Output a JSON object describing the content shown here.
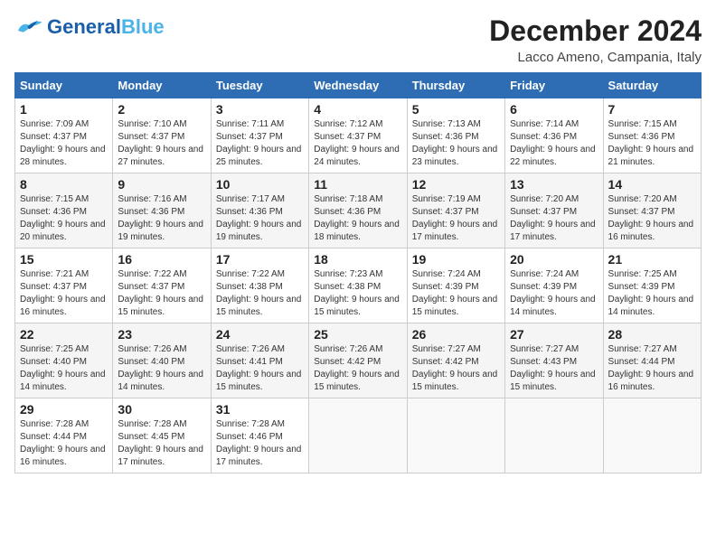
{
  "header": {
    "logo_general": "General",
    "logo_blue": "Blue",
    "month_title": "December 2024",
    "location": "Lacco Ameno, Campania, Italy"
  },
  "calendar": {
    "weekdays": [
      "Sunday",
      "Monday",
      "Tuesday",
      "Wednesday",
      "Thursday",
      "Friday",
      "Saturday"
    ],
    "weeks": [
      [
        null,
        null,
        null,
        null,
        null,
        null,
        null
      ]
    ],
    "days": [
      {
        "date": 1,
        "weekday": 0,
        "sunrise": "7:09 AM",
        "sunset": "4:37 PM",
        "daylight": "9 hours and 28 minutes"
      },
      {
        "date": 2,
        "weekday": 1,
        "sunrise": "7:10 AM",
        "sunset": "4:37 PM",
        "daylight": "9 hours and 27 minutes"
      },
      {
        "date": 3,
        "weekday": 2,
        "sunrise": "7:11 AM",
        "sunset": "4:37 PM",
        "daylight": "9 hours and 25 minutes"
      },
      {
        "date": 4,
        "weekday": 3,
        "sunrise": "7:12 AM",
        "sunset": "4:37 PM",
        "daylight": "9 hours and 24 minutes"
      },
      {
        "date": 5,
        "weekday": 4,
        "sunrise": "7:13 AM",
        "sunset": "4:36 PM",
        "daylight": "9 hours and 23 minutes"
      },
      {
        "date": 6,
        "weekday": 5,
        "sunrise": "7:14 AM",
        "sunset": "4:36 PM",
        "daylight": "9 hours and 22 minutes"
      },
      {
        "date": 7,
        "weekday": 6,
        "sunrise": "7:15 AM",
        "sunset": "4:36 PM",
        "daylight": "9 hours and 21 minutes"
      },
      {
        "date": 8,
        "weekday": 0,
        "sunrise": "7:15 AM",
        "sunset": "4:36 PM",
        "daylight": "9 hours and 20 minutes"
      },
      {
        "date": 9,
        "weekday": 1,
        "sunrise": "7:16 AM",
        "sunset": "4:36 PM",
        "daylight": "9 hours and 19 minutes"
      },
      {
        "date": 10,
        "weekday": 2,
        "sunrise": "7:17 AM",
        "sunset": "4:36 PM",
        "daylight": "9 hours and 19 minutes"
      },
      {
        "date": 11,
        "weekday": 3,
        "sunrise": "7:18 AM",
        "sunset": "4:36 PM",
        "daylight": "9 hours and 18 minutes"
      },
      {
        "date": 12,
        "weekday": 4,
        "sunrise": "7:19 AM",
        "sunset": "4:37 PM",
        "daylight": "9 hours and 17 minutes"
      },
      {
        "date": 13,
        "weekday": 5,
        "sunrise": "7:20 AM",
        "sunset": "4:37 PM",
        "daylight": "9 hours and 17 minutes"
      },
      {
        "date": 14,
        "weekday": 6,
        "sunrise": "7:20 AM",
        "sunset": "4:37 PM",
        "daylight": "9 hours and 16 minutes"
      },
      {
        "date": 15,
        "weekday": 0,
        "sunrise": "7:21 AM",
        "sunset": "4:37 PM",
        "daylight": "9 hours and 16 minutes"
      },
      {
        "date": 16,
        "weekday": 1,
        "sunrise": "7:22 AM",
        "sunset": "4:37 PM",
        "daylight": "9 hours and 15 minutes"
      },
      {
        "date": 17,
        "weekday": 2,
        "sunrise": "7:22 AM",
        "sunset": "4:38 PM",
        "daylight": "9 hours and 15 minutes"
      },
      {
        "date": 18,
        "weekday": 3,
        "sunrise": "7:23 AM",
        "sunset": "4:38 PM",
        "daylight": "9 hours and 15 minutes"
      },
      {
        "date": 19,
        "weekday": 4,
        "sunrise": "7:24 AM",
        "sunset": "4:39 PM",
        "daylight": "9 hours and 15 minutes"
      },
      {
        "date": 20,
        "weekday": 5,
        "sunrise": "7:24 AM",
        "sunset": "4:39 PM",
        "daylight": "9 hours and 14 minutes"
      },
      {
        "date": 21,
        "weekday": 6,
        "sunrise": "7:25 AM",
        "sunset": "4:39 PM",
        "daylight": "9 hours and 14 minutes"
      },
      {
        "date": 22,
        "weekday": 0,
        "sunrise": "7:25 AM",
        "sunset": "4:40 PM",
        "daylight": "9 hours and 14 minutes"
      },
      {
        "date": 23,
        "weekday": 1,
        "sunrise": "7:26 AM",
        "sunset": "4:40 PM",
        "daylight": "9 hours and 14 minutes"
      },
      {
        "date": 24,
        "weekday": 2,
        "sunrise": "7:26 AM",
        "sunset": "4:41 PM",
        "daylight": "9 hours and 15 minutes"
      },
      {
        "date": 25,
        "weekday": 3,
        "sunrise": "7:26 AM",
        "sunset": "4:42 PM",
        "daylight": "9 hours and 15 minutes"
      },
      {
        "date": 26,
        "weekday": 4,
        "sunrise": "7:27 AM",
        "sunset": "4:42 PM",
        "daylight": "9 hours and 15 minutes"
      },
      {
        "date": 27,
        "weekday": 5,
        "sunrise": "7:27 AM",
        "sunset": "4:43 PM",
        "daylight": "9 hours and 15 minutes"
      },
      {
        "date": 28,
        "weekday": 6,
        "sunrise": "7:27 AM",
        "sunset": "4:44 PM",
        "daylight": "9 hours and 16 minutes"
      },
      {
        "date": 29,
        "weekday": 0,
        "sunrise": "7:28 AM",
        "sunset": "4:44 PM",
        "daylight": "9 hours and 16 minutes"
      },
      {
        "date": 30,
        "weekday": 1,
        "sunrise": "7:28 AM",
        "sunset": "4:45 PM",
        "daylight": "9 hours and 17 minutes"
      },
      {
        "date": 31,
        "weekday": 2,
        "sunrise": "7:28 AM",
        "sunset": "4:46 PM",
        "daylight": "9 hours and 17 minutes"
      }
    ]
  }
}
